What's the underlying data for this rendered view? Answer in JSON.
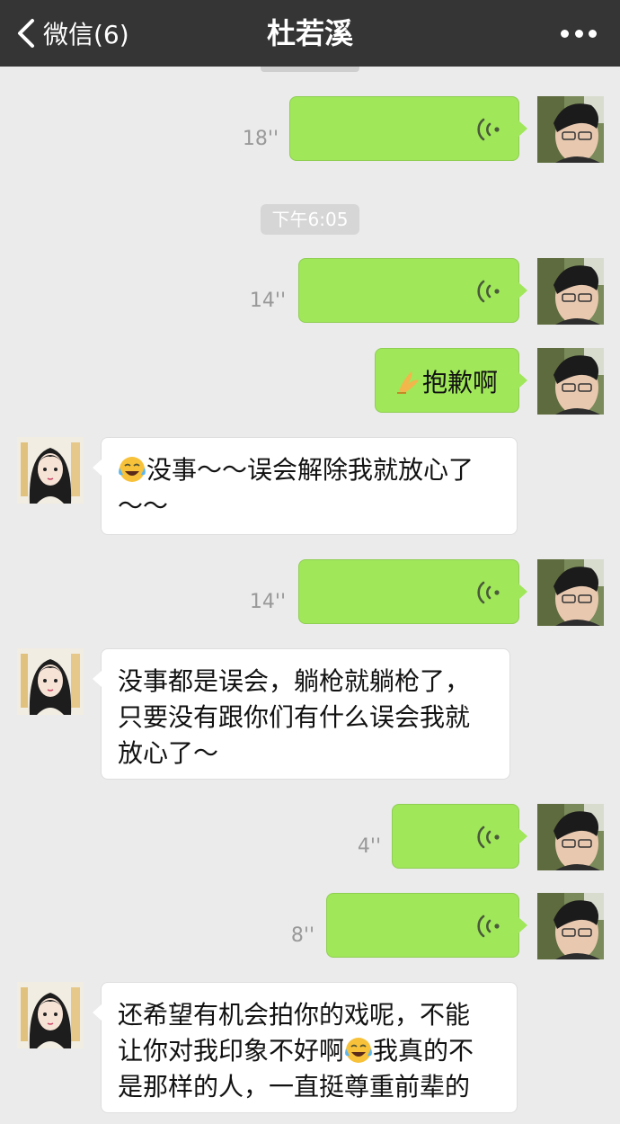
{
  "header": {
    "back_label": "微信(6)",
    "title": "杜若溪"
  },
  "timestamp": "下午6:05",
  "messages": [
    {
      "type": "voice",
      "side": "right",
      "duration": "18''"
    },
    {
      "type": "voice",
      "side": "right",
      "duration": "14''"
    },
    {
      "type": "text",
      "side": "right",
      "emoji": "pray-hands",
      "text": "抱歉啊"
    },
    {
      "type": "text",
      "side": "left",
      "emoji": "crying-laughing",
      "line1": "没事～～误会解除我就放心了",
      "line2": "～～"
    },
    {
      "type": "voice",
      "side": "right",
      "duration": "14''"
    },
    {
      "type": "text",
      "side": "left",
      "line1": "没事都是误会，躺枪就躺枪了，",
      "line2": "只要没有跟你们有什么误会我就",
      "line3": "放心了～"
    },
    {
      "type": "voice",
      "side": "right",
      "duration": "4''"
    },
    {
      "type": "voice",
      "side": "right",
      "duration": "8''"
    },
    {
      "type": "text",
      "side": "left",
      "line1": "还希望有机会拍你的戏呢，不能",
      "line2a": "让你对我印象不好啊",
      "emoji": "crying-laughing",
      "line2b": "我真的不",
      "line3": "是那样的人，一直挺尊重前辈的"
    }
  ],
  "colors": {
    "header_bg": "#353535",
    "chat_bg": "#ebebeb",
    "self_bubble": "#a0e75a",
    "other_bubble": "#ffffff"
  }
}
